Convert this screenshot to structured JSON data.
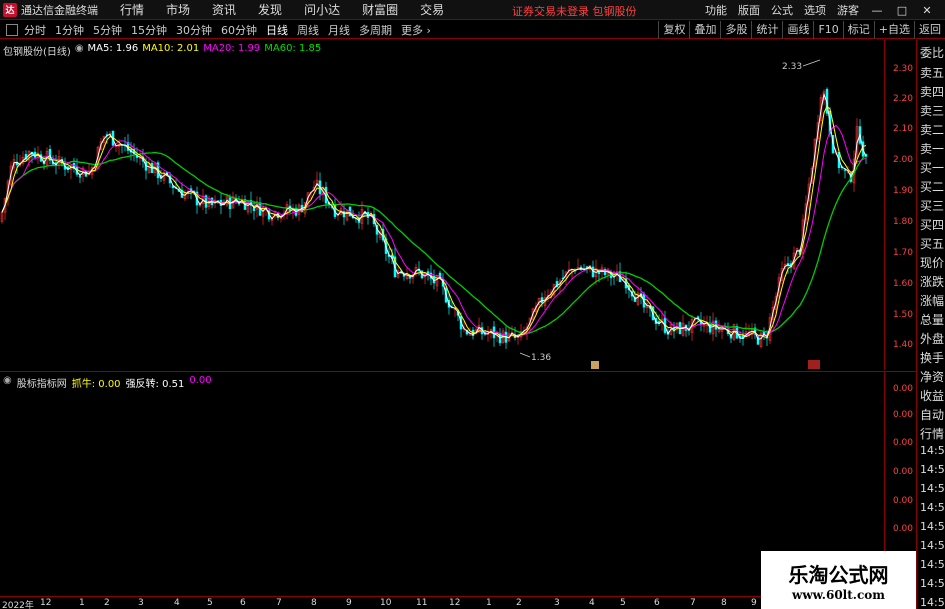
{
  "app": {
    "logo": "达",
    "name": "通达信金融终端"
  },
  "top_menu": [
    "行情",
    "市场",
    "资讯",
    "发现",
    "问小达",
    "财富圈",
    "交易"
  ],
  "notice": "证券交易未登录  包钢股份",
  "right_menu": [
    "功能",
    "版面",
    "公式",
    "选项",
    "游客"
  ],
  "periods": [
    "分时",
    "1分钟",
    "5分钟",
    "15分钟",
    "30分钟",
    "60分钟",
    "日线",
    "周线",
    "月线",
    "多周期",
    "更多"
  ],
  "active_period": "日线",
  "right_tools": [
    "复权",
    "叠加",
    "多股",
    "统计",
    "画线",
    "F10",
    "标记",
    "+自选",
    "返回"
  ],
  "chart": {
    "stock_label": "包钢股份(日线)",
    "ma5": "MA5: 1.96",
    "ma10": "MA10: 2.01",
    "ma20": "MA20: 1.99",
    "ma60": "MA60: 1.85",
    "high_label": "2.33",
    "low_label": "1.36",
    "colors": {
      "ma5": "#ffffff",
      "ma10": "#ffff00",
      "ma20": "#ff00ff",
      "ma60": "#00cc00",
      "up": "#ff3030",
      "down": "#00ffff",
      "axis": "#8b0000"
    }
  },
  "y_ticks": [
    "2.30",
    "2.20",
    "2.10",
    "2.00",
    "1.90",
    "1.80",
    "1.70",
    "1.60",
    "1.50",
    "1.40"
  ],
  "sidebar": [
    "委比",
    "卖五",
    "卖四",
    "卖三",
    "卖二",
    "卖一",
    "买一",
    "买二",
    "买三",
    "买四",
    "买五",
    "现价",
    "涨跌",
    "涨幅",
    "总量",
    "外盘",
    "换手",
    "净资",
    "收益",
    "自动",
    "行情"
  ],
  "sidebar_times": [
    "14:5",
    "14:5",
    "14:5",
    "14:5",
    "14:5",
    "14:5",
    "14:5",
    "14:5",
    "14:5"
  ],
  "indicator": {
    "name": "股标指标网",
    "a": "抓牛: 0.00",
    "b": "强反转: 0.51",
    "c": "0.00"
  },
  "ind_ticks": [
    "0.00",
    "0.00",
    "0.00",
    "0.00",
    "0.00",
    "0.00"
  ],
  "x_labels": [
    "2022年",
    "12",
    "1",
    "2",
    "3",
    "4",
    "5",
    "6",
    "7",
    "8",
    "9",
    "10",
    "11",
    "12",
    "1",
    "2",
    "3",
    "4",
    "5",
    "6",
    "7",
    "8",
    "9"
  ],
  "watermark": {
    "title": "乐淘公式网",
    "url": "www.60lt.com"
  }
}
